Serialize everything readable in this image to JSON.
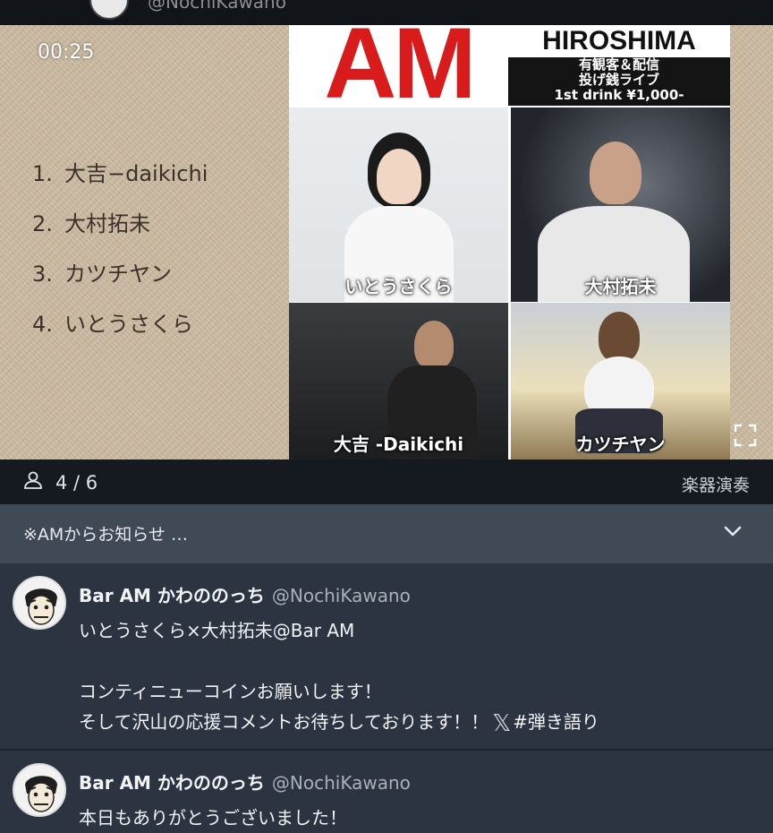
{
  "top": {
    "handle_partial": "@NochiKawano"
  },
  "video": {
    "timecode": "00:25",
    "setlist": [
      {
        "num": "1.",
        "title": "大吉−daikichi"
      },
      {
        "num": "2.",
        "title": "大村拓未"
      },
      {
        "num": "3.",
        "title": "カツチヤン"
      },
      {
        "num": "4.",
        "title": "いとうさくら"
      }
    ],
    "poster": {
      "logo": "AM",
      "city": "HIROSHIMA",
      "line1": "有観客＆配信",
      "line2": "投げ銭ライブ",
      "line3": "1st drink ¥1,000-",
      "captions": [
        "いとうさくら",
        "大村拓未",
        "大吉 -Daikichi",
        "カツチヤン"
      ]
    }
  },
  "meta": {
    "viewers": "4 / 6",
    "category": "楽器演奏"
  },
  "notice": {
    "text": "※AMからお知らせ …"
  },
  "posts": [
    {
      "name": "Bar AM かわののっち",
      "handle": "@NochiKawano",
      "line1": "いとうさくら×大村拓未@Bar AM",
      "line2": "コンティニューコインお願いします！",
      "line3": "そして沢山の応援コメントお待ちしております！！",
      "hashtag": "#弾き語り"
    },
    {
      "name": "Bar AM かわののっち",
      "handle": "@NochiKawano",
      "line1": "本日もありがとうございました！"
    }
  ],
  "icons": {
    "x_logo": "𝕏"
  }
}
